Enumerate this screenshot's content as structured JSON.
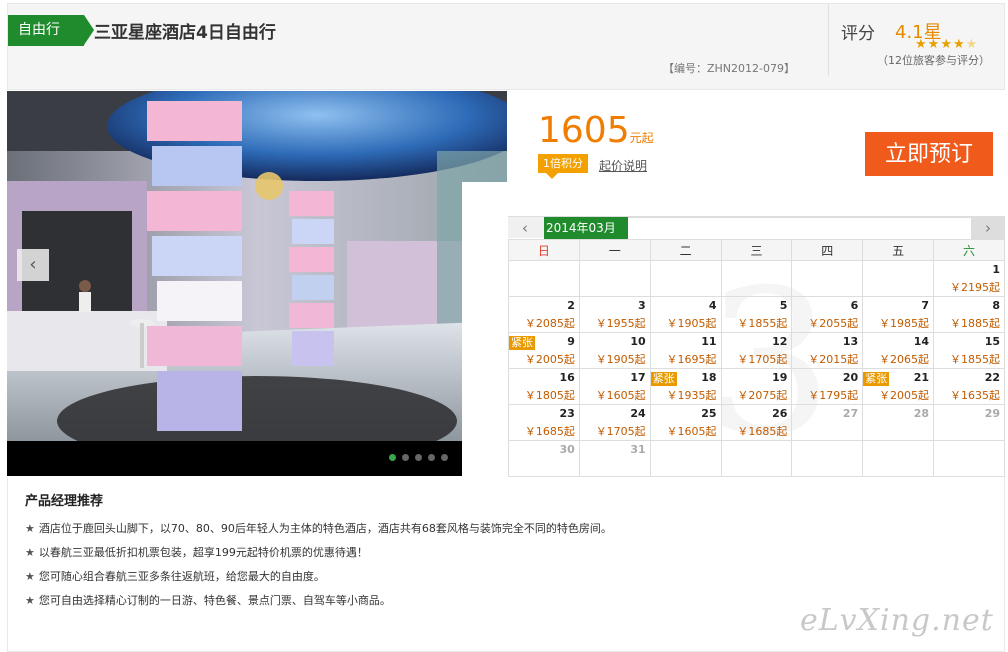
{
  "header": {
    "tag": "自由行",
    "title": "三亚星座酒店4日自由行",
    "code": "【编号：ZHN2012-079】",
    "rating_label": "评分",
    "rating_value": "4.1星",
    "stars": 4,
    "reviews": "（12位旅客参与评分）"
  },
  "gallery": {
    "prev_icon": "chevron-left-icon",
    "next_icon": "chevron-right-icon",
    "slide_count": 5,
    "active_slide": 1
  },
  "booking": {
    "price": "1605",
    "price_unit": "元起",
    "points_badge": "1倍积分",
    "price_note": "起价说明",
    "book_button": "立即预订"
  },
  "calendar": {
    "month": "2014年03月",
    "prev": "‹",
    "next": "›",
    "weekdays": [
      "日",
      "一",
      "二",
      "三",
      "四",
      "五",
      "六"
    ],
    "weeks": [
      [
        {
          "d": ""
        },
        {
          "d": ""
        },
        {
          "d": ""
        },
        {
          "d": ""
        },
        {
          "d": ""
        },
        {
          "d": ""
        },
        {
          "d": "1",
          "p": "￥2195起"
        }
      ],
      [
        {
          "d": "2",
          "p": "￥2085起"
        },
        {
          "d": "3",
          "p": "￥1955起"
        },
        {
          "d": "4",
          "p": "￥1905起"
        },
        {
          "d": "5",
          "p": "￥1855起"
        },
        {
          "d": "6",
          "p": "￥2055起"
        },
        {
          "d": "7",
          "p": "￥1985起"
        },
        {
          "d": "8",
          "p": "￥1885起"
        }
      ],
      [
        {
          "d": "9",
          "p": "￥2005起",
          "tag": "紧张"
        },
        {
          "d": "10",
          "p": "￥1905起"
        },
        {
          "d": "11",
          "p": "￥1695起"
        },
        {
          "d": "12",
          "p": "￥1705起"
        },
        {
          "d": "13",
          "p": "￥2015起"
        },
        {
          "d": "14",
          "p": "￥2065起"
        },
        {
          "d": "15",
          "p": "￥1855起"
        }
      ],
      [
        {
          "d": "16",
          "p": "￥1805起"
        },
        {
          "d": "17",
          "p": "￥1605起"
        },
        {
          "d": "18",
          "p": "￥1935起",
          "tag": "紧张"
        },
        {
          "d": "19",
          "p": "￥2075起"
        },
        {
          "d": "20",
          "p": "￥1795起"
        },
        {
          "d": "21",
          "p": "￥2005起",
          "tag": "紧张"
        },
        {
          "d": "22",
          "p": "￥1635起"
        }
      ],
      [
        {
          "d": "23",
          "p": "￥1685起"
        },
        {
          "d": "24",
          "p": "￥1705起"
        },
        {
          "d": "25",
          "p": "￥1605起"
        },
        {
          "d": "26",
          "p": "￥1685起"
        },
        {
          "d": "27",
          "past": true
        },
        {
          "d": "28",
          "past": true
        },
        {
          "d": "29",
          "past": true
        }
      ],
      [
        {
          "d": "30",
          "past": true
        },
        {
          "d": "31",
          "past": true
        },
        {
          "d": ""
        },
        {
          "d": ""
        },
        {
          "d": ""
        },
        {
          "d": ""
        },
        {
          "d": ""
        }
      ]
    ]
  },
  "recommend": {
    "title": "产品经理推荐",
    "items": [
      "酒店位于鹿回头山脚下，以70、80、90后年轻人为主体的特色酒店，酒店共有68套风格与装饰完全不同的特色房间。",
      "以春航三亚最低折扣机票包装，超享199元起特价机票的优惠待遇！",
      "您可随心组合春航三亚多条往返航班，给您最大的自由度。",
      "您可自由选择精心订制的一日游、特色餐、景点门票、自驾车等小商品。"
    ]
  },
  "watermark": "eLvXing.net",
  "colors": {
    "accent_green": "#1f8b2c",
    "price_orange": "#f07d00",
    "button_orange": "#f05a1a"
  }
}
